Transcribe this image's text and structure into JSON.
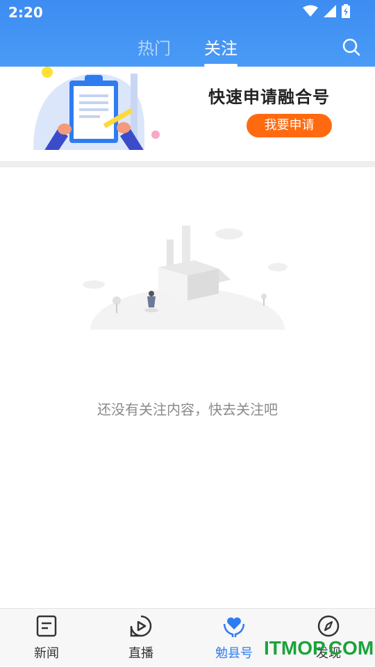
{
  "status_bar": {
    "time": "2:20"
  },
  "header": {
    "tabs": [
      {
        "label": "热门",
        "active": false
      },
      {
        "label": "关注",
        "active": true
      }
    ],
    "search_icon": "search-icon",
    "bg_color": "#4a9bf6"
  },
  "banner": {
    "title": "快速申请融合号",
    "button_label": "我要申请",
    "button_color": "#ff6a10"
  },
  "empty_state": {
    "message": "还没有关注内容，快去关注吧"
  },
  "bottom_nav": {
    "items": [
      {
        "label": "新闻",
        "icon": "news-icon",
        "active": false
      },
      {
        "label": "直播",
        "icon": "play-icon",
        "active": false
      },
      {
        "label": "勉县号",
        "icon": "heart-hands-icon",
        "active": true
      },
      {
        "label": "发现",
        "icon": "compass-icon",
        "active": false
      }
    ],
    "active_color": "#2f7cf0"
  },
  "watermark": "ITMOP.COM"
}
